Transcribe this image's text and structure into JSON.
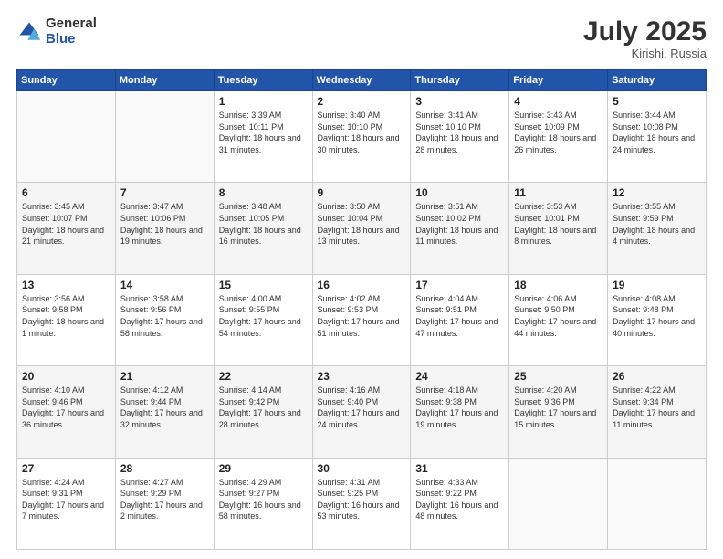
{
  "header": {
    "logo_general": "General",
    "logo_blue": "Blue",
    "month": "July 2025",
    "location": "Kirishi, Russia"
  },
  "days_of_week": [
    "Sunday",
    "Monday",
    "Tuesday",
    "Wednesday",
    "Thursday",
    "Friday",
    "Saturday"
  ],
  "weeks": [
    [
      {
        "day": "",
        "info": ""
      },
      {
        "day": "",
        "info": ""
      },
      {
        "day": "1",
        "info": "Sunrise: 3:39 AM\nSunset: 10:11 PM\nDaylight: 18 hours and 31 minutes."
      },
      {
        "day": "2",
        "info": "Sunrise: 3:40 AM\nSunset: 10:10 PM\nDaylight: 18 hours and 30 minutes."
      },
      {
        "day": "3",
        "info": "Sunrise: 3:41 AM\nSunset: 10:10 PM\nDaylight: 18 hours and 28 minutes."
      },
      {
        "day": "4",
        "info": "Sunrise: 3:43 AM\nSunset: 10:09 PM\nDaylight: 18 hours and 26 minutes."
      },
      {
        "day": "5",
        "info": "Sunrise: 3:44 AM\nSunset: 10:08 PM\nDaylight: 18 hours and 24 minutes."
      }
    ],
    [
      {
        "day": "6",
        "info": "Sunrise: 3:45 AM\nSunset: 10:07 PM\nDaylight: 18 hours and 21 minutes."
      },
      {
        "day": "7",
        "info": "Sunrise: 3:47 AM\nSunset: 10:06 PM\nDaylight: 18 hours and 19 minutes."
      },
      {
        "day": "8",
        "info": "Sunrise: 3:48 AM\nSunset: 10:05 PM\nDaylight: 18 hours and 16 minutes."
      },
      {
        "day": "9",
        "info": "Sunrise: 3:50 AM\nSunset: 10:04 PM\nDaylight: 18 hours and 13 minutes."
      },
      {
        "day": "10",
        "info": "Sunrise: 3:51 AM\nSunset: 10:02 PM\nDaylight: 18 hours and 11 minutes."
      },
      {
        "day": "11",
        "info": "Sunrise: 3:53 AM\nSunset: 10:01 PM\nDaylight: 18 hours and 8 minutes."
      },
      {
        "day": "12",
        "info": "Sunrise: 3:55 AM\nSunset: 9:59 PM\nDaylight: 18 hours and 4 minutes."
      }
    ],
    [
      {
        "day": "13",
        "info": "Sunrise: 3:56 AM\nSunset: 9:58 PM\nDaylight: 18 hours and 1 minute."
      },
      {
        "day": "14",
        "info": "Sunrise: 3:58 AM\nSunset: 9:56 PM\nDaylight: 17 hours and 58 minutes."
      },
      {
        "day": "15",
        "info": "Sunrise: 4:00 AM\nSunset: 9:55 PM\nDaylight: 17 hours and 54 minutes."
      },
      {
        "day": "16",
        "info": "Sunrise: 4:02 AM\nSunset: 9:53 PM\nDaylight: 17 hours and 51 minutes."
      },
      {
        "day": "17",
        "info": "Sunrise: 4:04 AM\nSunset: 9:51 PM\nDaylight: 17 hours and 47 minutes."
      },
      {
        "day": "18",
        "info": "Sunrise: 4:06 AM\nSunset: 9:50 PM\nDaylight: 17 hours and 44 minutes."
      },
      {
        "day": "19",
        "info": "Sunrise: 4:08 AM\nSunset: 9:48 PM\nDaylight: 17 hours and 40 minutes."
      }
    ],
    [
      {
        "day": "20",
        "info": "Sunrise: 4:10 AM\nSunset: 9:46 PM\nDaylight: 17 hours and 36 minutes."
      },
      {
        "day": "21",
        "info": "Sunrise: 4:12 AM\nSunset: 9:44 PM\nDaylight: 17 hours and 32 minutes."
      },
      {
        "day": "22",
        "info": "Sunrise: 4:14 AM\nSunset: 9:42 PM\nDaylight: 17 hours and 28 minutes."
      },
      {
        "day": "23",
        "info": "Sunrise: 4:16 AM\nSunset: 9:40 PM\nDaylight: 17 hours and 24 minutes."
      },
      {
        "day": "24",
        "info": "Sunrise: 4:18 AM\nSunset: 9:38 PM\nDaylight: 17 hours and 19 minutes."
      },
      {
        "day": "25",
        "info": "Sunrise: 4:20 AM\nSunset: 9:36 PM\nDaylight: 17 hours and 15 minutes."
      },
      {
        "day": "26",
        "info": "Sunrise: 4:22 AM\nSunset: 9:34 PM\nDaylight: 17 hours and 11 minutes."
      }
    ],
    [
      {
        "day": "27",
        "info": "Sunrise: 4:24 AM\nSunset: 9:31 PM\nDaylight: 17 hours and 7 minutes."
      },
      {
        "day": "28",
        "info": "Sunrise: 4:27 AM\nSunset: 9:29 PM\nDaylight: 17 hours and 2 minutes."
      },
      {
        "day": "29",
        "info": "Sunrise: 4:29 AM\nSunset: 9:27 PM\nDaylight: 16 hours and 58 minutes."
      },
      {
        "day": "30",
        "info": "Sunrise: 4:31 AM\nSunset: 9:25 PM\nDaylight: 16 hours and 53 minutes."
      },
      {
        "day": "31",
        "info": "Sunrise: 4:33 AM\nSunset: 9:22 PM\nDaylight: 16 hours and 48 minutes."
      },
      {
        "day": "",
        "info": ""
      },
      {
        "day": "",
        "info": ""
      }
    ]
  ]
}
